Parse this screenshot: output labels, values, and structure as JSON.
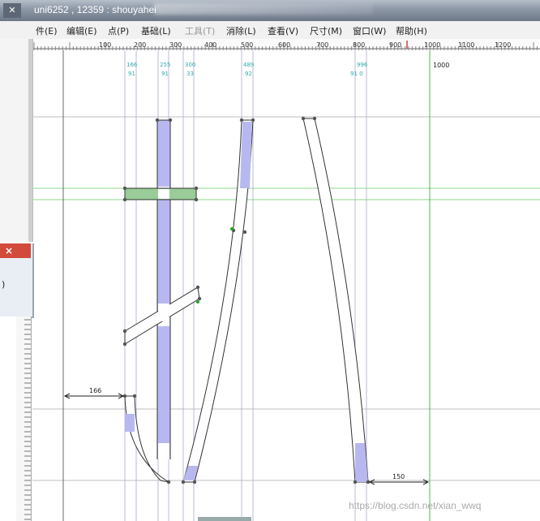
{
  "window": {
    "title": "uni6252 , 12359 : shouyahei",
    "icon": "window-icon"
  },
  "menu": [
    {
      "label": "件(E)"
    },
    {
      "label": "编辑(E)"
    },
    {
      "label": "点(P)"
    },
    {
      "label": "基础(L)"
    },
    {
      "label": "工具(T)"
    },
    {
      "label": "消除(L)"
    },
    {
      "label": "查看(V)"
    },
    {
      "label": "尺寸(M)"
    },
    {
      "label": "窗口(W)"
    },
    {
      "label": "帮助(H)"
    }
  ],
  "ruler": {
    "ticks": [
      "100",
      "200",
      "300",
      "400",
      "500",
      "600",
      "700",
      "800",
      "900",
      "1000",
      "1100",
      "1200"
    ]
  },
  "canvas": {
    "guide_labels": [
      {
        "top": "166",
        "bottom": "91"
      },
      {
        "top": "255",
        "bottom": "91"
      },
      {
        "top": "300",
        "bottom": "33"
      },
      {
        "top": "489",
        "bottom": "92"
      },
      {
        "top": "996",
        "bottom": "91 0"
      }
    ],
    "top_right_value": "1000",
    "dimension_left": "166",
    "dimension_right": "150"
  },
  "dialog": {
    "close": "×",
    "text": ")"
  },
  "watermark": "https://blog.csdn.net/xian_wwq"
}
